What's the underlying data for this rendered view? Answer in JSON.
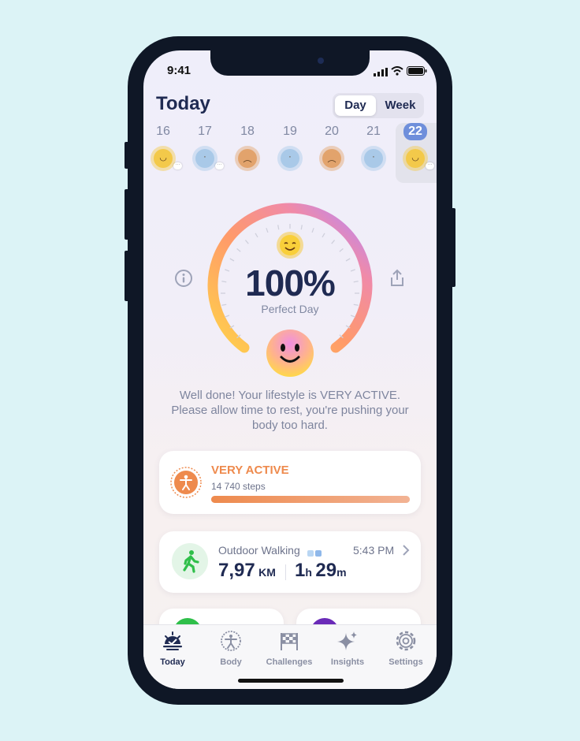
{
  "status_bar": {
    "time": "9:41"
  },
  "header": {
    "title": "Today",
    "toggle": {
      "day": "Day",
      "week": "Week"
    }
  },
  "week": {
    "days": [
      {
        "num": "16",
        "face": "happy",
        "color": "#f3c94a",
        "has_note": true
      },
      {
        "num": "17",
        "face": "calm",
        "color": "#a9c9e8",
        "has_note": true
      },
      {
        "num": "18",
        "face": "grumpy",
        "color": "#e2a36c",
        "has_note": false
      },
      {
        "num": "19",
        "face": "calm",
        "color": "#a9c9e8",
        "has_note": false
      },
      {
        "num": "20",
        "face": "grumpy",
        "color": "#e2a36c",
        "has_note": false
      },
      {
        "num": "21",
        "face": "calm",
        "color": "#a9c9e8",
        "has_note": false
      },
      {
        "num": "22",
        "face": "happy",
        "color": "#f3c94a",
        "has_note": true,
        "selected": true
      }
    ]
  },
  "gauge": {
    "value_text": "100%",
    "value": 1.0,
    "label": "Perfect Day",
    "sun_icon": "sun-happy-icon"
  },
  "message": "Well done! Your lifestyle is VERY ACTIVE. Please allow time to rest, you're pushing your body too hard.",
  "activity_card": {
    "level": "VERY ACTIVE",
    "steps": "14 740 steps",
    "progress": 1.0,
    "accent": "#ee8a4d"
  },
  "workout_card": {
    "name": "Outdoor Walking",
    "time": "5:43 PM",
    "distance_value": "7,97",
    "distance_unit": "KM",
    "duration_h": "1",
    "duration_h_unit": "h",
    "duration_m": "29",
    "duration_m_unit": "m",
    "accent": "#2fbf4a"
  },
  "tabs": [
    {
      "label": "Today",
      "icon": "sunrise-icon",
      "active": true
    },
    {
      "label": "Body",
      "icon": "body-icon",
      "active": false
    },
    {
      "label": "Challenges",
      "icon": "flag-icon",
      "active": false
    },
    {
      "label": "Insights",
      "icon": "sparkle-icon",
      "active": false
    },
    {
      "label": "Settings",
      "icon": "gear-icon",
      "active": false
    }
  ]
}
